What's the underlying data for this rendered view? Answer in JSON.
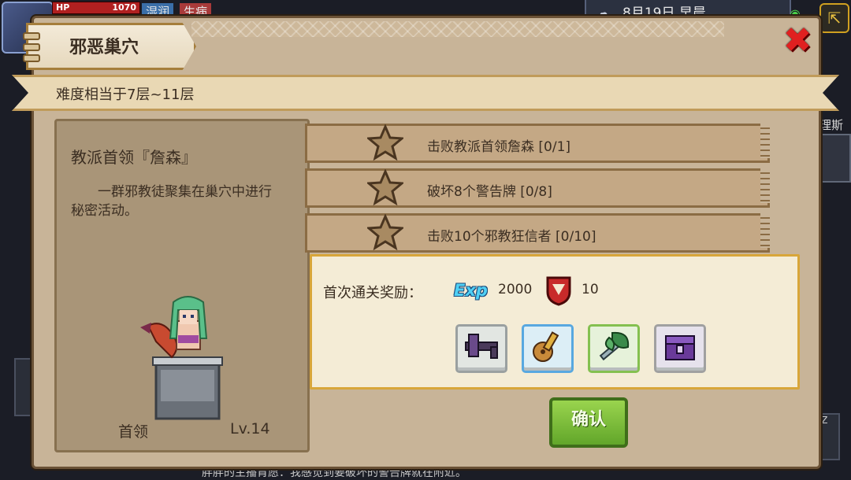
{
  "hud": {
    "hp_label": "HP",
    "hp_value": "1070",
    "status_wet": "湿润",
    "status_sick": "生病",
    "date_time": "8月19日  早晨",
    "side_text": "理斯",
    "side_small": "zZ",
    "chat_line": "胖胖的主播肯愿：我感觉到要破坏的警告牌就在附近。"
  },
  "dialog": {
    "title": "邪恶巢穴",
    "difficulty": "难度相当于7层~11层",
    "boss": {
      "name": "教派首领『詹森』",
      "description": "一群邪教徒聚集在巢穴中进行秘密活动。",
      "role_label": "首领",
      "level": "Lv.14"
    },
    "objectives": [
      {
        "text": "击败教派首领詹森 [0/1]"
      },
      {
        "text": "破坏8个警告牌 [0/8]"
      },
      {
        "text": "击败10个邪教狂信者 [0/10]"
      }
    ],
    "reward": {
      "label": "首次通关奖励：",
      "exp_badge": "Exp",
      "exp_value": "2000",
      "shield_value": "10",
      "items": [
        "dark-crossbow-icon",
        "lute-icon",
        "leaf-axe-icon",
        "purple-chest-icon"
      ]
    },
    "confirm_label": "确认"
  },
  "colors": {
    "panel_bg": "#c8b498",
    "reward_border": "#d8a63a",
    "confirm_green": "#7fbf3a",
    "close_red": "#e02020"
  }
}
